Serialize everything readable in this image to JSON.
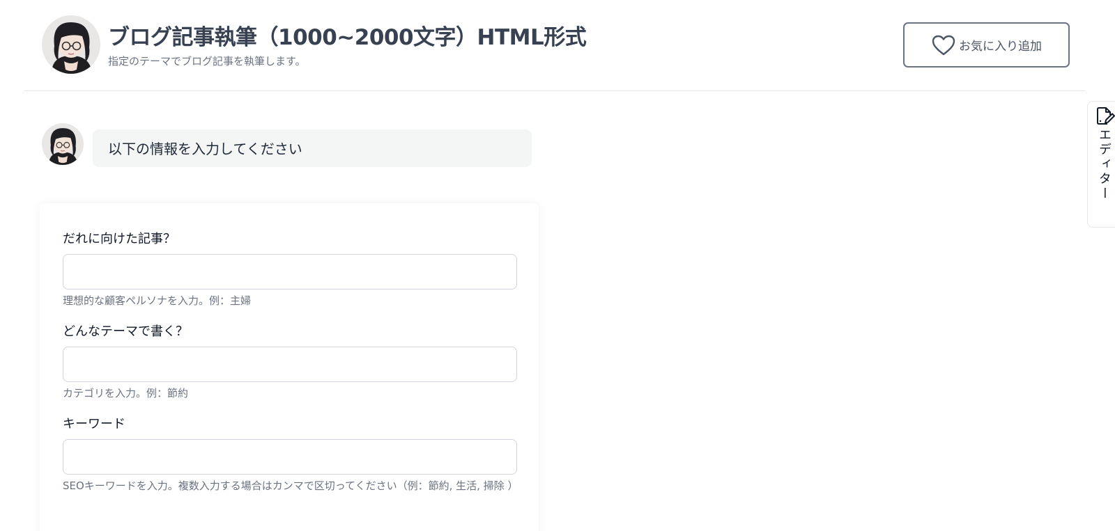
{
  "header": {
    "avatar_icon": "anime-girl-avatar-icon",
    "title": "ブログ記事執筆（1000~2000文字）HTML形式",
    "subtitle": "指定のテーマでブログ記事を執筆します。",
    "favorite_button": {
      "icon": "heart-icon",
      "label": "お気に入り追加"
    }
  },
  "chat": {
    "avatar_icon": "anime-girl-avatar-icon",
    "message": "以下の情報を入力してください"
  },
  "form": {
    "fields": [
      {
        "label": "だれに向けた記事？",
        "value": "",
        "help": "理想的な顧客ペルソナを入力。例：主婦"
      },
      {
        "label": "どんなテーマで書く？",
        "value": "",
        "help": "カテゴリを入力。例：節約"
      },
      {
        "label": "キーワード",
        "value": "",
        "help": "SEOキーワードを入力。複数入力する場合はカンマで区切ってください（例：節約, 生活, 掃除 ）"
      }
    ]
  },
  "editor_tab": {
    "icon": "edit-document-icon",
    "label": "エディター"
  },
  "colors": {
    "title": "#374151",
    "muted": "#6b7280",
    "bubble_bg": "#f3f6f5",
    "border": "#d1d5db"
  }
}
